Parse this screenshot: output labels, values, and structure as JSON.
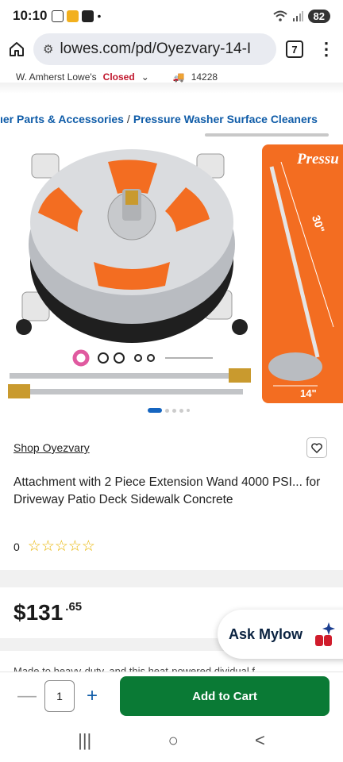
{
  "status": {
    "time": "10:10",
    "dot": "•",
    "battery": "82"
  },
  "browser": {
    "url": "lowes.com/pd/Oyezvary-14-I",
    "tab_count": "7"
  },
  "store": {
    "name": "W. Amherst Lowe's",
    "status": "Closed",
    "zip": "14228"
  },
  "breadcrumb": {
    "crumb1": "ıer Parts & Accessories",
    "separator": "/",
    "crumb2": "Pressure Washer Surface Cleaners"
  },
  "gallery": {
    "image1_label": "Pressure Washer Surface Cleaner",
    "image2_brand": "Pressu",
    "image2_length": "30\"",
    "image2_width": "14\""
  },
  "product": {
    "shop_link": "Shop Oyezvary",
    "title": "Attachment with 2 Piece Extension Wand 4000 PSI... for Driveway Patio Deck Sidewalk Concrete",
    "review_count": "0",
    "stars": "☆☆☆☆☆"
  },
  "price": {
    "dollars": "$131",
    "cents": ".65"
  },
  "assistant": {
    "label": "Ask Mylow"
  },
  "description_peek": "Made to heavy-duty, and this heat-powered dividual f...",
  "cart": {
    "quantity": "1",
    "minus": "—",
    "plus": "+",
    "add_label": "Add to Cart"
  },
  "nav": {
    "recents": "|||",
    "home": "○",
    "back": "<"
  },
  "colors": {
    "accent_blue": "#0f5ca8",
    "cart_green": "#0a7a35",
    "orange": "#f36d21",
    "closed_red": "#c0162c"
  }
}
